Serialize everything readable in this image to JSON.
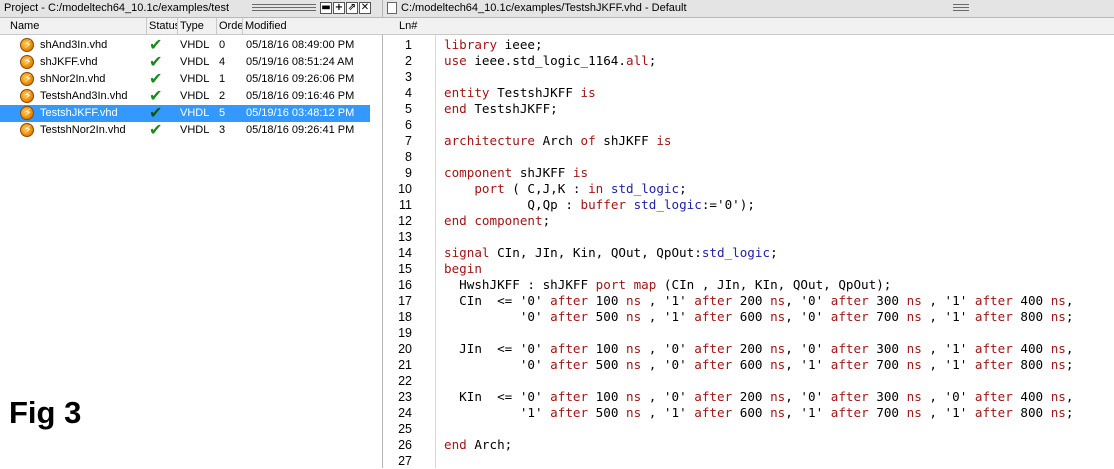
{
  "project_pane": {
    "title": "Project - C:/modeltech64_10.1c/examples/test",
    "buttons": {
      "add": "+",
      "undock": "⇗",
      "close": "✕"
    },
    "columns": [
      "Name",
      "Status",
      "Type",
      "Order",
      "Modified"
    ],
    "files": [
      {
        "name": "shAnd3In.vhd",
        "type": "VHDL",
        "order": "0",
        "modified": "05/18/16 08:49:00 PM",
        "status": "check-icon",
        "selected": false
      },
      {
        "name": "shJKFF.vhd",
        "type": "VHDL",
        "order": "4",
        "modified": "05/19/16 08:51:24 AM",
        "status": "check-icon",
        "selected": false
      },
      {
        "name": "shNor2In.vhd",
        "type": "VHDL",
        "order": "1",
        "modified": "05/18/16 09:26:06 PM",
        "status": "check-icon",
        "selected": false
      },
      {
        "name": "TestshAnd3In.vhd",
        "type": "VHDL",
        "order": "2",
        "modified": "05/18/16 09:16:46 PM",
        "status": "check-icon",
        "selected": false
      },
      {
        "name": "TestshJKFF.vhd",
        "type": "VHDL",
        "order": "5",
        "modified": "05/19/16 03:48:12 PM",
        "status": "check-icon",
        "selected": true
      },
      {
        "name": "TestshNor2In.vhd",
        "type": "VHDL",
        "order": "3",
        "modified": "05/18/16 09:26:41 PM",
        "status": "check-icon",
        "selected": false
      }
    ],
    "figure_label": "Fig 3"
  },
  "source_pane": {
    "title": "C:/modeltech64_10.1c/examples/TestshJKFF.vhd - Default",
    "line_header": "Ln#",
    "lines": [
      "library ieee;",
      "use ieee.std_logic_1164.all;",
      "",
      "entity TestshJKFF is",
      "end TestshJKFF;",
      "",
      "architecture Arch of shJKFF is",
      "",
      "component shJKFF is",
      "    port ( C,J,K : in std_logic;",
      "           Q,Qp : buffer std_logic:='0');",
      "end component;",
      "",
      "signal CIn, JIn, Kin, QOut, QpOut:std_logic;",
      "begin",
      "  HwshJKFF : shJKFF port map (CIn , JIn, KIn, QOut, QpOut);",
      "  CIn  <= '0' after 100 ns , '1' after 200 ns, '0' after 300 ns , '1' after 400 ns,",
      "          '0' after 500 ns , '1' after 600 ns, '0' after 700 ns , '1' after 800 ns;",
      "",
      "  JIn  <= '0' after 100 ns , '0' after 200 ns, '0' after 300 ns , '1' after 400 ns,",
      "          '0' after 500 ns , '0' after 600 ns, '1' after 700 ns , '1' after 800 ns;",
      "",
      "  KIn  <= '0' after 100 ns , '0' after 200 ns, '0' after 300 ns , '0' after 400 ns,",
      "          '1' after 500 ns , '1' after 600 ns, '1' after 700 ns , '1' after 800 ns;",
      "",
      "end Arch;",
      ""
    ]
  },
  "colors": {
    "selection": "#3399ff",
    "keyword": "#a31515",
    "type": "#2222aa",
    "status_ok": "#1a8a1a"
  }
}
